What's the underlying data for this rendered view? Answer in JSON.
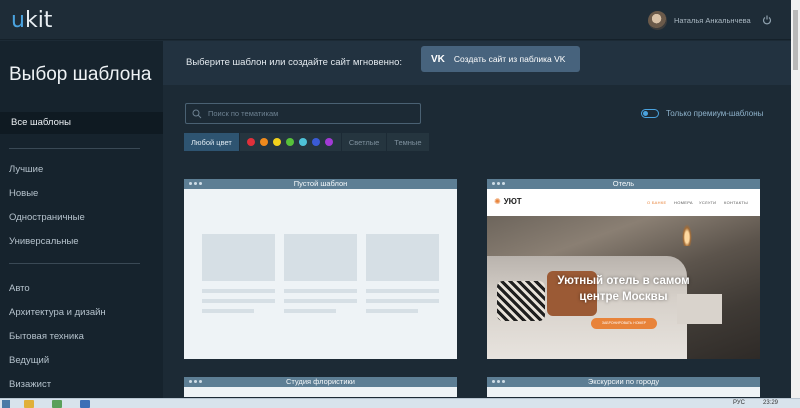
{
  "app": {
    "logo_u": "u",
    "logo_rest": "kit"
  },
  "user": {
    "name": "Наталья Анкальнчева"
  },
  "sidebar": {
    "title": "Выбор шаблона",
    "all_label": "Все шаблоны",
    "group1": [
      "Лучшие",
      "Новые",
      "Одностраничные",
      "Универсальные"
    ],
    "group2": [
      "Авто",
      "Архитектура и дизайн",
      "Бытовая техника",
      "Ведущий",
      "Визажист"
    ]
  },
  "banner": {
    "text": "Выберите шаблон или создайте сайт мгновенно:",
    "vk_logo": "VK",
    "vk_button": "Создать сайт из паблика VK"
  },
  "search": {
    "placeholder": "Поиск по тематикам"
  },
  "premium_toggle": {
    "label": "Только премиум-шаблоны",
    "on": false
  },
  "filters": {
    "any_color": "Любой цвет",
    "swatches": [
      "#e0303a",
      "#f08a1c",
      "#f2d11c",
      "#57c23a",
      "#4ec2d8",
      "#3a5bd6",
      "#a23ad6"
    ],
    "light": "Светлые",
    "dark": "Темные"
  },
  "cards": {
    "blank": {
      "title": "Пустой шаблон"
    },
    "hotel": {
      "title": "Отель",
      "logo": "УЮТ",
      "menu": [
        "О БАНКЕ",
        "НОМЕРА",
        "УСЛУГИ",
        "КОНТАКТЫ"
      ],
      "hero_line1": "Уютный отель в самом",
      "hero_line2": "центре Москвы",
      "hero_button": "ЗАБРОНИРОВАТЬ НОМЕР"
    },
    "florist": {
      "title": "Студия флористики"
    },
    "tours": {
      "title": "Экскурсии по городу"
    }
  },
  "taskbar": {
    "lang": "РУС",
    "time": "23:29"
  },
  "colors": {
    "accent": "#4aa3df",
    "sidebar_bg": "#16232d",
    "main_bg": "#1c2a35",
    "orange": "#e8833a"
  }
}
